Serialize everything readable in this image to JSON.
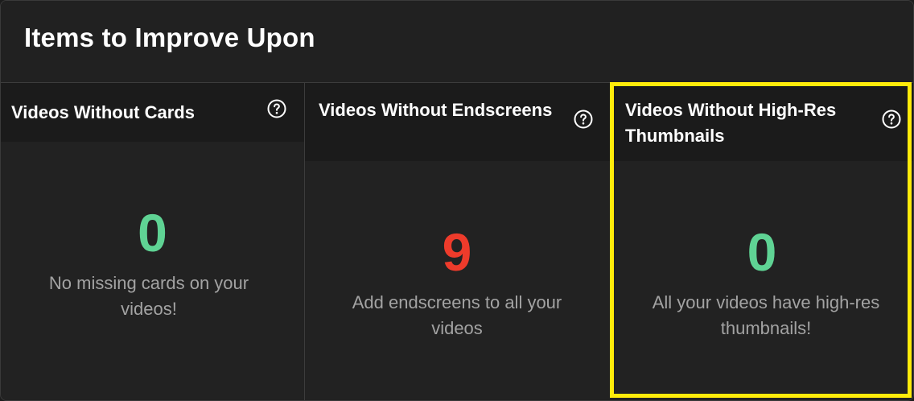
{
  "panel": {
    "title": "Items to Improve Upon"
  },
  "cards": [
    {
      "title": "Videos Without Cards",
      "count": "0",
      "message": "No missing cards on your videos!",
      "status": "good"
    },
    {
      "title": "Videos Without Endscreens",
      "count": "9",
      "message": "Add endscreens to all your videos",
      "status": "bad"
    },
    {
      "title": "Videos Without High-Res Thumbnails",
      "count": "0",
      "message": "All your videos have high-res thumbnails!",
      "status": "good",
      "highlighted": true
    }
  ],
  "icons": {
    "help": "help-circle-icon"
  },
  "colors": {
    "good": "#5fd394",
    "bad": "#ee3b2b",
    "highlight": "#ffeb0a",
    "muted_text": "#a3a3a3"
  }
}
